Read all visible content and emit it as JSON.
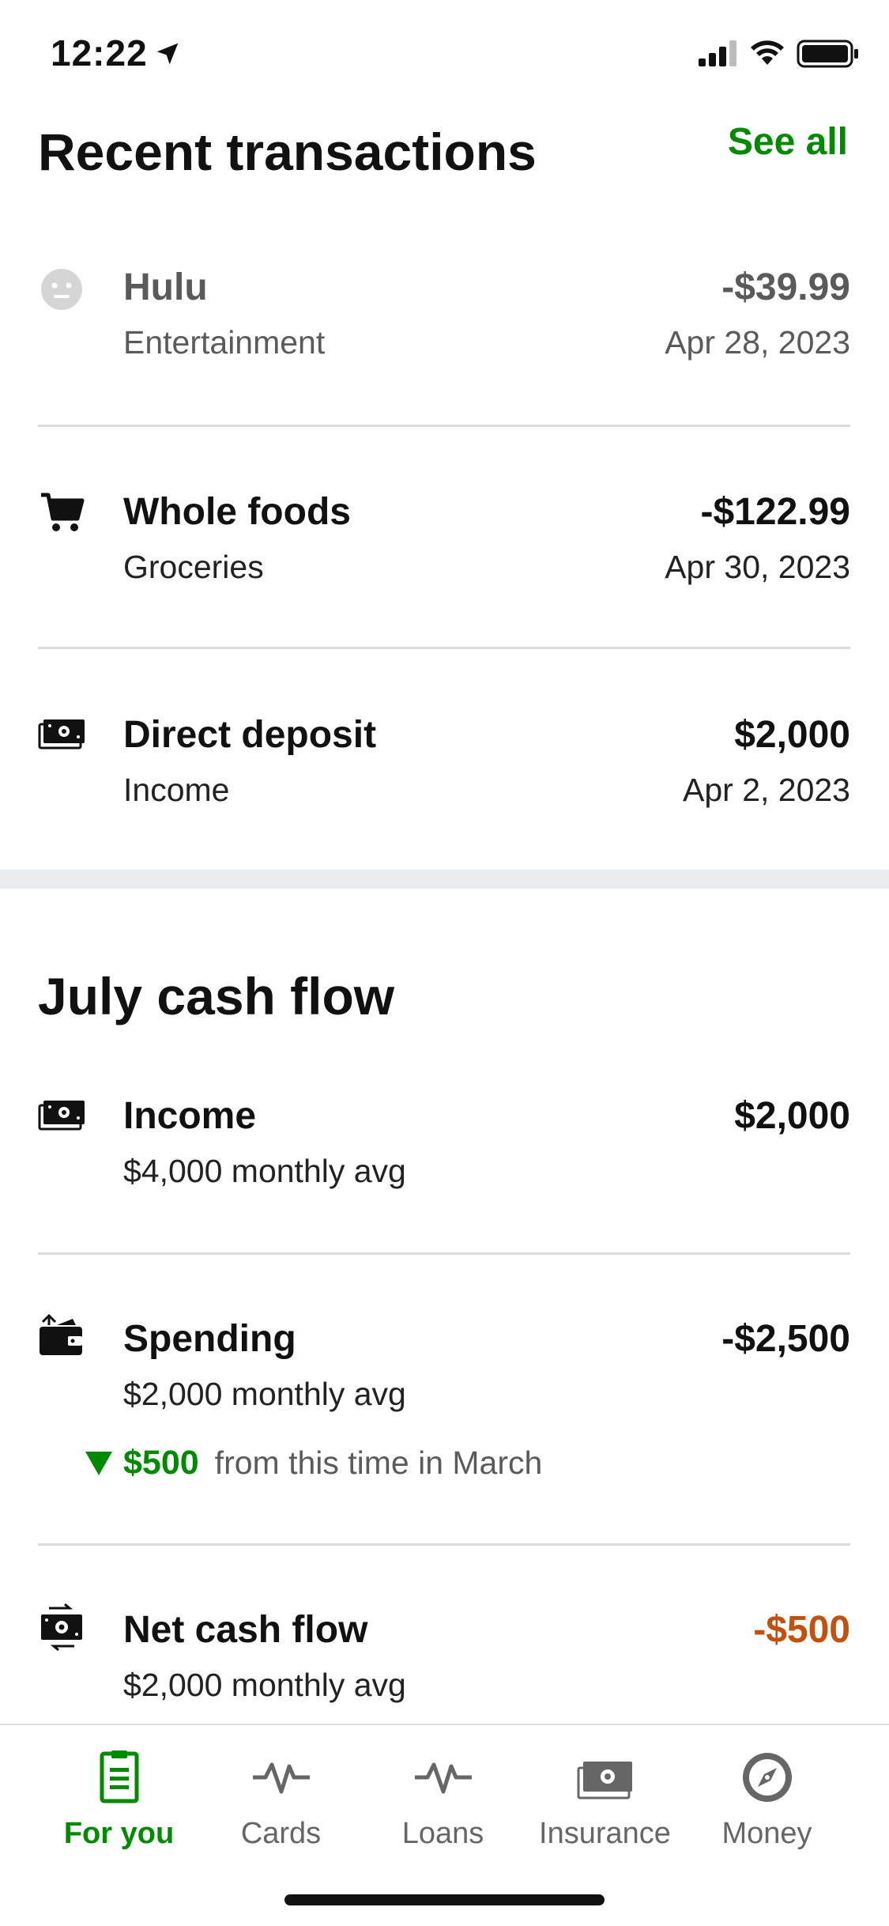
{
  "status_bar": {
    "time": "12:22"
  },
  "recent": {
    "title": "Recent transactions",
    "see_all": "See all",
    "items": [
      {
        "icon": "face-icon",
        "name": "Hulu",
        "category": "Entertainment",
        "amount": "-$39.99",
        "date": "Apr 28, 2023"
      },
      {
        "icon": "cart-icon",
        "name": "Whole foods",
        "category": "Groceries",
        "amount": "-$122.99",
        "date": "Apr 30, 2023"
      },
      {
        "icon": "cash-icon",
        "name": "Direct deposit",
        "category": "Income",
        "amount": "$2,000",
        "date": "Apr 2, 2023"
      }
    ]
  },
  "cash_flow": {
    "title": "July cash flow",
    "items": [
      {
        "icon": "cash-icon",
        "name": "Income",
        "sub": "$4,000 monthly avg",
        "amount": "$2,000"
      },
      {
        "icon": "wallet-icon",
        "name": "Spending",
        "sub": "$2,000 monthly avg",
        "amount": "-$2,500",
        "delta": {
          "value": "$500",
          "text": "from this time in March"
        }
      },
      {
        "icon": "cash-exchange-icon",
        "name": "Net cash flow",
        "sub": "$2,000 monthly avg",
        "amount": "-$500"
      }
    ]
  },
  "nav": {
    "items": [
      {
        "label": "For you",
        "icon": "document-icon",
        "active": true
      },
      {
        "label": "Cards",
        "icon": "pulse-icon"
      },
      {
        "label": "Loans",
        "icon": "pulse-icon"
      },
      {
        "label": "Insurance",
        "icon": "cash-icon"
      },
      {
        "label": "Money",
        "icon": "compass-icon"
      }
    ]
  },
  "colors": {
    "accent_green": "#008a00",
    "negative_orange": "#c4500f",
    "muted_gray": "#5a5a5a"
  }
}
